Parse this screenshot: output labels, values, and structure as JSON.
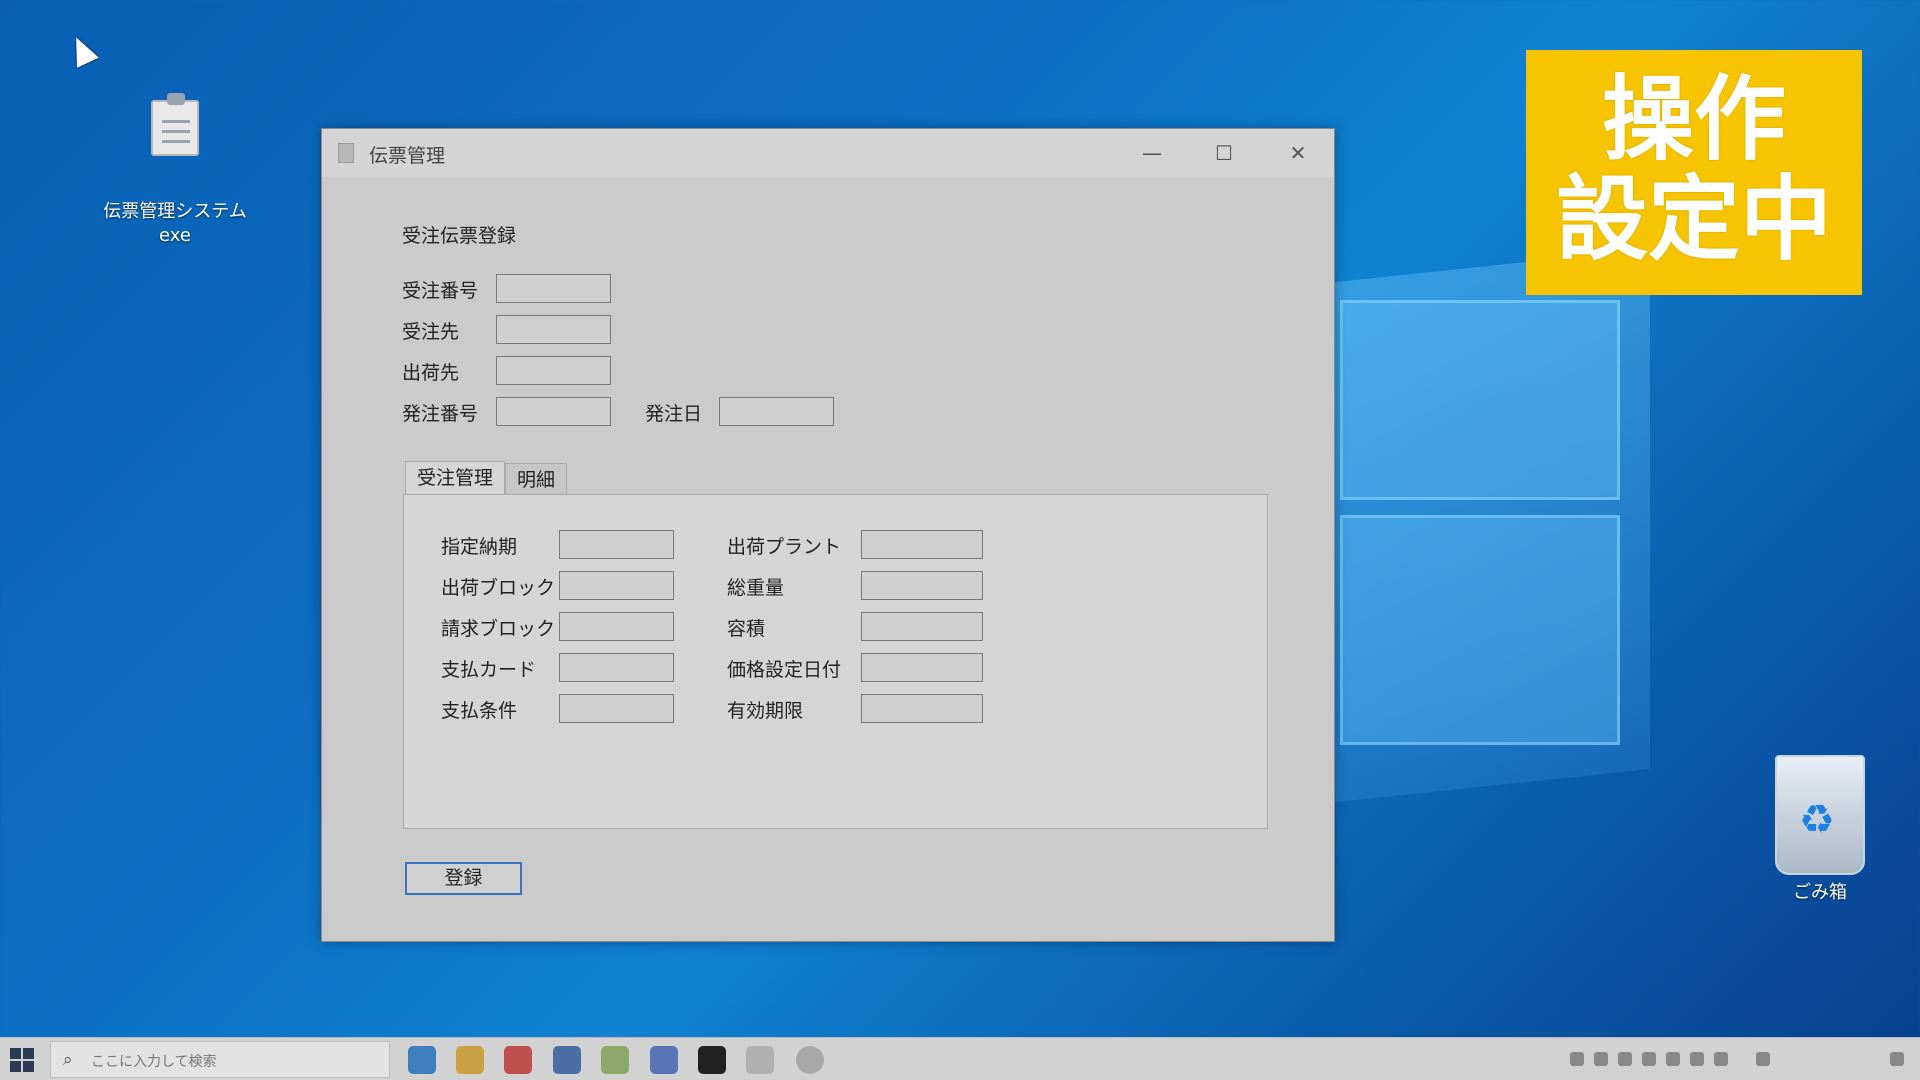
{
  "desktop": {
    "exe_icon_label": "伝票管理システム",
    "exe_icon_ext": "exe",
    "recycle_bin_label": "ごみ箱"
  },
  "badge": {
    "line1": "操作",
    "line2": "設定中",
    "color": "#f6c400"
  },
  "window": {
    "title": "伝票管理",
    "minimize_glyph": "—",
    "maximize_glyph": "☐",
    "close_glyph": "✕"
  },
  "form": {
    "heading": "受注伝票登録",
    "fields": {
      "order_number": {
        "label": "受注番号",
        "value": ""
      },
      "customer": {
        "label": "受注先",
        "value": ""
      },
      "ship_to": {
        "label": "出荷先",
        "value": ""
      },
      "po_number": {
        "label": "発注番号",
        "value": ""
      },
      "po_date": {
        "label": "発注日",
        "value": ""
      }
    },
    "tabs": [
      {
        "label": "受注管理",
        "active": true
      },
      {
        "label": "明細",
        "active": false
      }
    ],
    "tab_fields": {
      "delivery_date": {
        "label": "指定納期",
        "value": ""
      },
      "ship_block": {
        "label": "出荷ブロック",
        "value": ""
      },
      "bill_block": {
        "label": "請求ブロック",
        "value": ""
      },
      "payment_card": {
        "label": "支払カード",
        "value": ""
      },
      "payment_terms": {
        "label": "支払条件",
        "value": ""
      },
      "ship_plant": {
        "label": "出荷プラント",
        "value": ""
      },
      "gross_weight": {
        "label": "総重量",
        "value": ""
      },
      "volume": {
        "label": "容積",
        "value": ""
      },
      "price_date": {
        "label": "価格設定日付",
        "value": ""
      },
      "expiry": {
        "label": "有効期限",
        "value": ""
      }
    },
    "register_button": "登録"
  },
  "taskbar": {
    "search_placeholder": "ここに入力して検索",
    "start_icon": "windows-start-icon"
  },
  "colors": {
    "accent": "#3a76c0",
    "desktop_bg": "#0b6fc4"
  }
}
